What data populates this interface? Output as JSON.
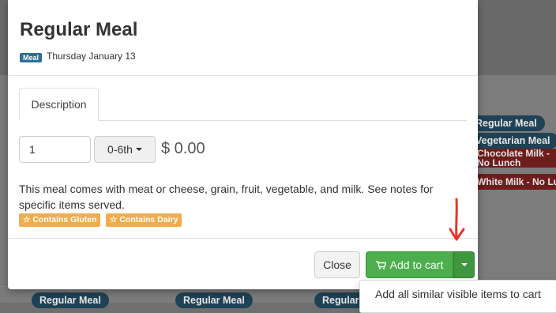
{
  "background": {
    "right_pills": [
      {
        "text": "Regular Meal",
        "kind": "blue"
      },
      {
        "text": "Vegetarian Meal",
        "kind": "blue"
      },
      {
        "text": "Chocolate Milk - No Lunch",
        "kind": "red"
      },
      {
        "text": "White Milk - No Lunch",
        "kind": "red"
      }
    ],
    "bottom_pills": [
      "Regular Meal",
      "Regular Meal",
      "Regular Meal"
    ]
  },
  "modal": {
    "title": "Regular Meal",
    "badge": "Meal",
    "date": "Thursday January 13",
    "tab_label": "Description",
    "quantity_value": "1",
    "grade_label": "0-6th",
    "price": "$ 0.00",
    "description": "This meal comes with meat or cheese, grain, fruit, vegetable, and milk. See notes for specific items served.",
    "tags": [
      "☆ Contains Gluten",
      "☆ Contains Dairy"
    ],
    "close_label": "Close",
    "add_to_cart_label": "Add to cart",
    "dropdown_item": "Add all similar visible items to cart"
  },
  "colors": {
    "primary_badge": "#2f6f95",
    "success": "#4cae4c",
    "warning": "#f0ad4e",
    "annotation": "#e8332a"
  },
  "icons": {
    "cart": "cart-icon",
    "dropdown": "caret-down-icon",
    "annotation": "red-arrow-icon"
  }
}
